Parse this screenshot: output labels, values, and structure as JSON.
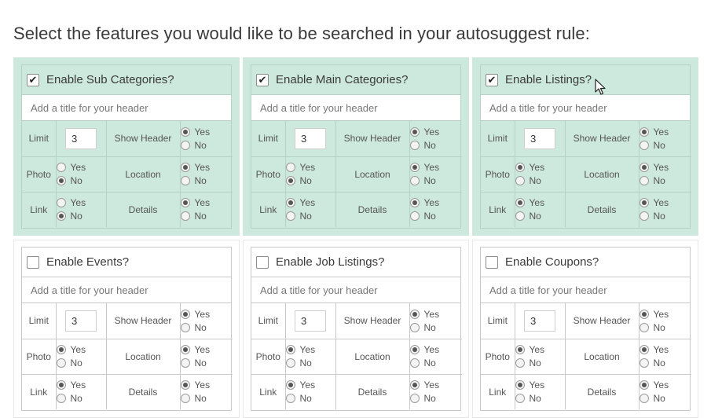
{
  "page": {
    "title": "Select the features you would like to be searched in your autosuggest rule:"
  },
  "labels": {
    "limit": "Limit",
    "show_header": "Show Header",
    "photo": "Photo",
    "location": "Location",
    "link": "Link",
    "details": "Details",
    "yes": "Yes",
    "no": "No"
  },
  "icons": {
    "checkbox_check": "check-icon",
    "cursor": "mouse-pointer-icon"
  },
  "colors": {
    "enabled_bg": "#cde8dc",
    "disabled_bg": "#ffffff",
    "border": "#c9c9c9"
  },
  "cards": [
    {
      "title": "Enable Sub Categories?",
      "enabled": true,
      "header_placeholder": "Add a title for your header",
      "limit": "3",
      "show_header": "yes",
      "photo": "no",
      "location": "yes",
      "link": "no",
      "details": "yes"
    },
    {
      "title": "Enable Main Categories?",
      "enabled": true,
      "header_placeholder": "Add a title for your header",
      "limit": "3",
      "show_header": "yes",
      "photo": "no",
      "location": "yes",
      "link": "yes",
      "details": "yes"
    },
    {
      "title": "Enable Listings?",
      "enabled": true,
      "header_placeholder": "Add a title for your header",
      "limit": "3",
      "show_header": "yes",
      "photo": "yes",
      "location": "yes",
      "link": "yes",
      "details": "yes"
    },
    {
      "title": "Enable Events?",
      "enabled": false,
      "header_placeholder": "Add a title for your header",
      "limit": "3",
      "show_header": "yes",
      "photo": "yes",
      "location": "yes",
      "link": "yes",
      "details": "yes"
    },
    {
      "title": "Enable Job Listings?",
      "enabled": false,
      "header_placeholder": "Add a title for your header",
      "limit": "3",
      "show_header": "yes",
      "photo": "yes",
      "location": "yes",
      "link": "yes",
      "details": "yes"
    },
    {
      "title": "Enable Coupons?",
      "enabled": false,
      "header_placeholder": "Add a title for your header",
      "limit": "3",
      "show_header": "yes",
      "photo": "yes",
      "location": "yes",
      "link": "yes",
      "details": "yes"
    }
  ]
}
